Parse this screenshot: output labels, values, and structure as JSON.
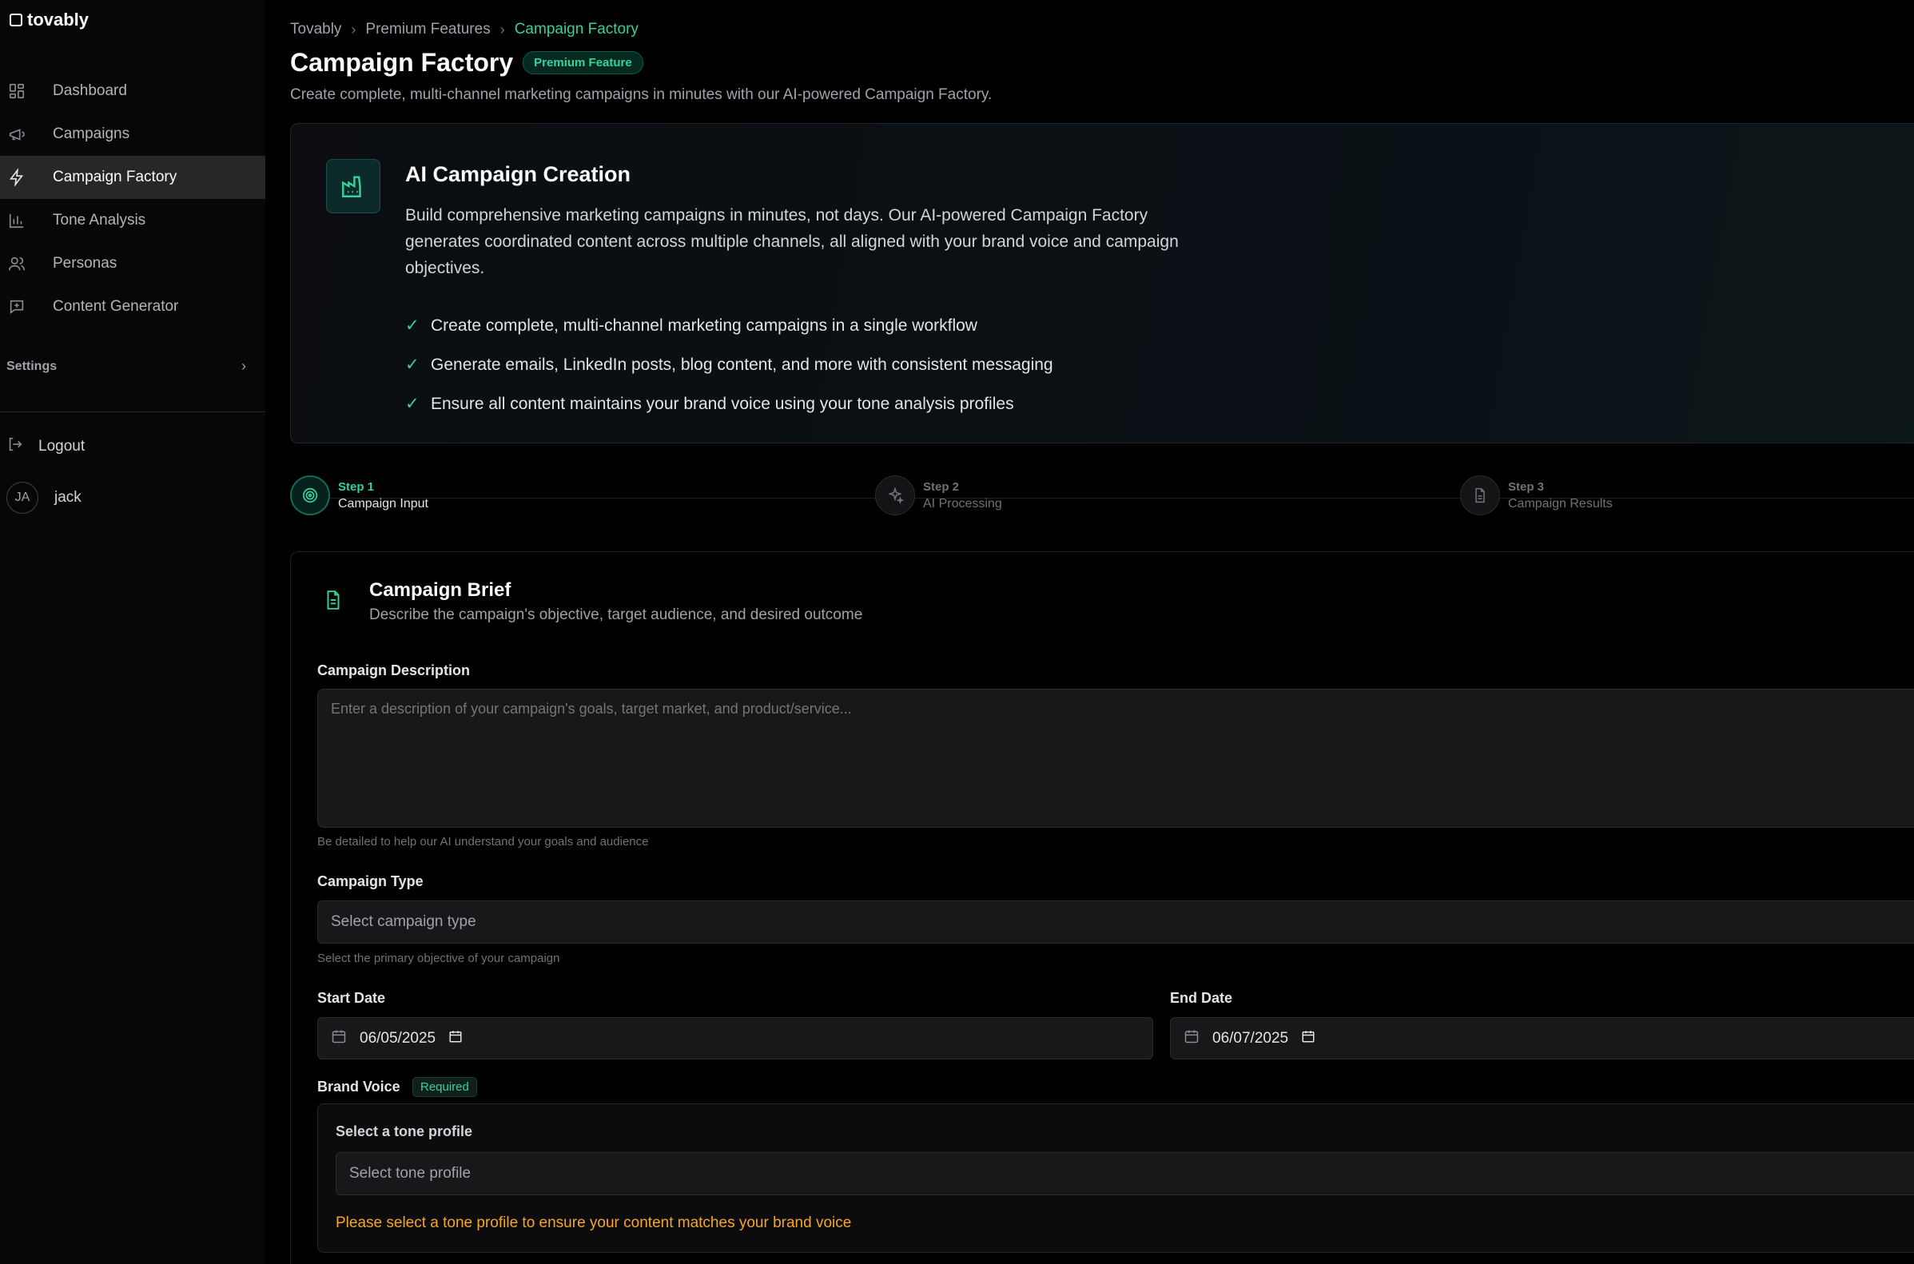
{
  "app": {
    "logo_text": "tovably"
  },
  "sidebar": {
    "items": [
      {
        "label": "Dashboard",
        "icon": "dashboard-icon",
        "active": false
      },
      {
        "label": "Campaigns",
        "icon": "megaphone-icon",
        "active": false
      },
      {
        "label": "Campaign Factory",
        "icon": "lightning-icon",
        "active": true
      },
      {
        "label": "Tone Analysis",
        "icon": "bar-chart-icon",
        "active": false
      },
      {
        "label": "Personas",
        "icon": "users-icon",
        "active": false
      },
      {
        "label": "Content Generator",
        "icon": "message-plus-icon",
        "active": false
      }
    ],
    "settings_label": "Settings",
    "logout_label": "Logout",
    "user": {
      "initials": "JA",
      "name": "jack"
    }
  },
  "breadcrumb": [
    "Tovably",
    "Premium Features",
    "Campaign Factory"
  ],
  "page": {
    "title": "Campaign Factory",
    "badge": "Premium Feature",
    "subtitle": "Create complete, multi-channel marketing campaigns in minutes with our AI-powered Campaign Factory."
  },
  "hero": {
    "title": "AI Campaign Creation",
    "description": "Build comprehensive marketing campaigns in minutes, not days. Our AI-powered Campaign Factory generates coordinated content across multiple channels, all aligned with your brand voice and campaign objectives.",
    "features": [
      "Create complete, multi-channel marketing campaigns in a single workflow",
      "Generate emails, LinkedIn posts, blog content, and more with consistent messaging",
      "Ensure all content maintains your brand voice using your tone analysis profiles"
    ]
  },
  "steps": [
    {
      "num": "Step 1",
      "label": "Campaign Input",
      "active": true
    },
    {
      "num": "Step 2",
      "label": "AI Processing",
      "active": false
    },
    {
      "num": "Step 3",
      "label": "Campaign Results",
      "active": false
    }
  ],
  "form": {
    "title": "Campaign Brief",
    "subtitle": "Describe the campaign's objective, target audience, and desired outcome",
    "description_label": "Campaign Description",
    "description_placeholder": "Enter a description of your campaign's goals, target market, and product/service...",
    "description_help": "Be detailed to help our AI understand your goals and audience",
    "type_label": "Campaign Type",
    "type_placeholder": "Select campaign type",
    "type_help": "Select the primary objective of your campaign",
    "start_label": "Start Date",
    "start_value": "06/05/2025",
    "end_label": "End Date",
    "end_value": "06/07/2025",
    "voice_label": "Brand Voice",
    "voice_required": "Required",
    "tone_label": "Select a tone profile",
    "tone_placeholder": "Select tone profile",
    "tone_warning": "Please select a tone profile to ensure your content matches your brand voice"
  },
  "colors": {
    "accent": "#34d399",
    "warning": "#f5a623",
    "background": "#000000",
    "active_nav": "#27272a"
  }
}
